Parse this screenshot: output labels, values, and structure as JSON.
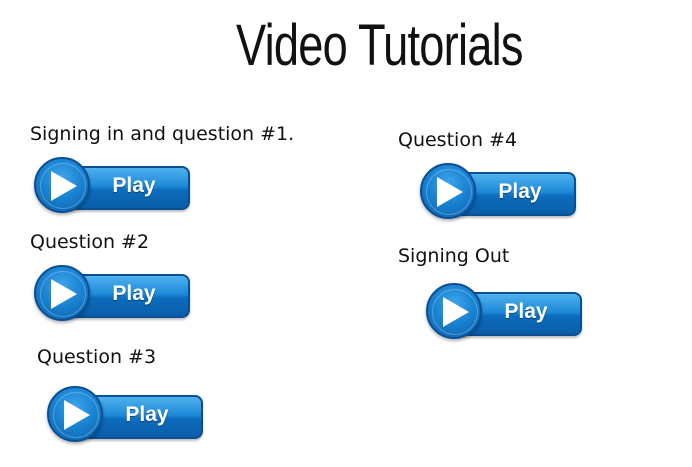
{
  "page": {
    "title": "Video Tutorials"
  },
  "tutorials": [
    {
      "label": "Signing in and question #1.",
      "button_label": "Play",
      "icon": "play-icon"
    },
    {
      "label": "Question #2",
      "button_label": "Play",
      "icon": "play-icon"
    },
    {
      "label": "Question #3",
      "button_label": "Play",
      "icon": "play-icon"
    },
    {
      "label": "Question #4",
      "button_label": "Play",
      "icon": "play-icon"
    },
    {
      "label": "Signing Out",
      "button_label": "Play",
      "icon": "play-icon"
    }
  ],
  "colors": {
    "button_blue": "#1a84d2",
    "button_border": "#0a4f93",
    "text": "#111111",
    "background": "#ffffff"
  }
}
